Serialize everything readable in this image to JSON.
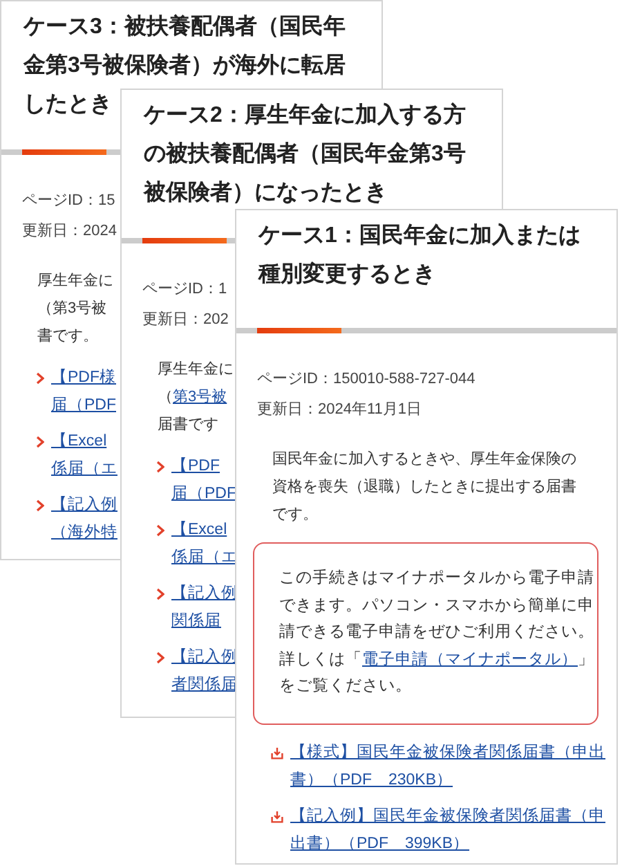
{
  "cards": [
    {
      "title_lines": [
        "ケース3：被扶養配偶者（国民年",
        "金第3号被保険者）が海外に転居",
        "したとき"
      ],
      "page_id": "ページID：15",
      "updated": "更新日：2024",
      "body": [
        {
          "text": "厚生年金に"
        },
        {
          "text": "（第3号被"
        },
        {
          "text": "書です。"
        }
      ],
      "links": [
        {
          "kind": "chevron",
          "lines": [
            "【PDF様",
            "届（PDF"
          ]
        },
        {
          "kind": "chevron",
          "lines": [
            "【Excel",
            "係届（エ"
          ]
        },
        {
          "kind": "chevron",
          "lines": [
            "【記入例",
            "（海外特"
          ]
        }
      ]
    },
    {
      "title_lines": [
        "ケース2：厚生年金に加入する方",
        "の被扶養配偶者（国民年金第3号",
        "被保険者）になったとき"
      ],
      "page_id": "ページID：1",
      "updated": "更新日：202",
      "body": [
        {
          "text": "厚生年金に"
        },
        {
          "text": "（",
          "link": "第3号被"
        },
        {
          "text": "届書です"
        }
      ],
      "links": [
        {
          "kind": "chevron",
          "lines": [
            "【PDF",
            "届（PDF"
          ]
        },
        {
          "kind": "chevron",
          "lines": [
            "【Excel",
            "係届（エ"
          ]
        },
        {
          "kind": "chevron",
          "lines": [
            "【記入例",
            "関係届"
          ]
        },
        {
          "kind": "chevron",
          "lines": [
            "【記入例",
            "者関係届"
          ]
        }
      ]
    },
    {
      "title_lines": [
        "ケース1：国民年金に加入または",
        "種別変更するとき"
      ],
      "page_id": "ページID：150010-588-727-044",
      "updated": "更新日：2024年11月1日",
      "body": [
        {
          "text": "国民年金に加入するときや、厚生年金保険の"
        },
        {
          "text": "資格を喪失（退職）したときに提出する届書"
        },
        {
          "text": "です。"
        }
      ],
      "notice": {
        "lines": [
          "この手続きはマイナポータルから電子申請",
          "できます。パソコン・スマホから簡単に申",
          "請できる電子申請をぜひご利用ください。"
        ],
        "link_prefix": "詳しくは「",
        "link": "電子申請（マイナポータル）",
        "link_suffix": "」",
        "last_line": "をご覧ください。"
      },
      "links": [
        {
          "kind": "download",
          "lines": [
            "【様式】国民年金被保険者関係届書（申出",
            "書）（PDF　230KB）"
          ]
        },
        {
          "kind": "download",
          "lines": [
            "【記入例】国民年金被保険者関係届書（申",
            "出書）（PDF　399KB）"
          ]
        }
      ]
    }
  ]
}
